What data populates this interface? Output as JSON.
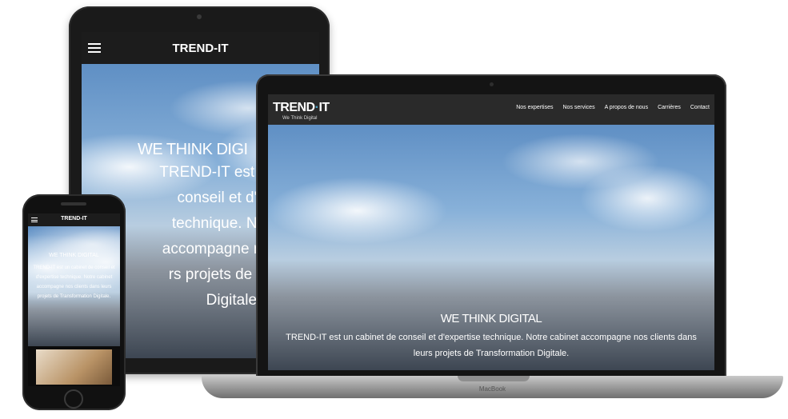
{
  "brand": "TREND-IT",
  "logo": {
    "main": "TREND",
    "separator": "·",
    "accent": "IT",
    "tagline": "We Think Digital"
  },
  "nav": [
    "Nos expertises",
    "Nos services",
    "A propos de nous",
    "Carrières",
    "Contact"
  ],
  "hero": {
    "title": "WE THINK DIGITAL",
    "text": "TREND-IT est un cabinet de conseil et d'expertise technique. Notre cabinet accompagne nos clients dans leurs projets de Transformation Digitale."
  },
  "tablet": {
    "title": "WE THINK DIGI",
    "lines": [
      "TREND-IT est un cabi",
      "conseil et d'expe",
      "technique. Notre c",
      "accompagne nos clie",
      "rs projets de Transf",
      "Digitale."
    ]
  },
  "laptop": {
    "label": "MacBook"
  },
  "colors": {
    "accent": "#4aa6c9",
    "nav_bg": "#2a2a2a"
  }
}
